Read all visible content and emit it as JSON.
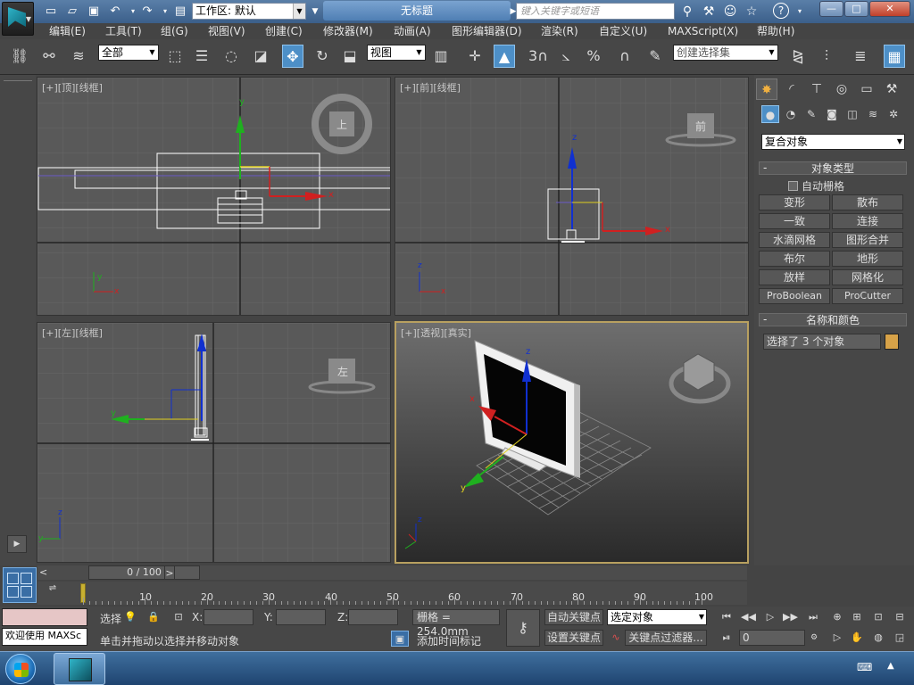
{
  "titlebar": {
    "workspace_label": "工作区: 默认",
    "window_title": "无标题",
    "search_placeholder": "键入关键字或短语",
    "min": "—",
    "max": "□",
    "close": "✕",
    "help": "?"
  },
  "menu": [
    "编辑(E)",
    "工具(T)",
    "组(G)",
    "视图(V)",
    "创建(C)",
    "修改器(M)",
    "动画(A)",
    "图形编辑器(D)",
    "渲染(R)",
    "自定义(U)",
    "MAXScript(X)",
    "帮助(H)"
  ],
  "toolbar": {
    "filter_value": "全部",
    "refcoord_value": "视图",
    "named_selection_placeholder": "创建选择集",
    "snap_label": "3",
    "percent_label": "%"
  },
  "viewports": {
    "top": {
      "label": "[+][顶][线框]",
      "cube": "上"
    },
    "front": {
      "label": "[+][前][线框]",
      "cube": "前"
    },
    "left": {
      "label": "[+][左][线框]",
      "cube": "左"
    },
    "perspective": {
      "label": "[+][透视][真实]"
    }
  },
  "axes": {
    "x": "x",
    "y": "y",
    "z": "z"
  },
  "command_panel": {
    "category_value": "复合对象",
    "object_type_title": "对象类型",
    "autogrid_label": "自动栅格",
    "buttons": [
      "变形",
      "散布",
      "一致",
      "连接",
      "水滴网格",
      "图形合并",
      "布尔",
      "地形",
      "放样",
      "网格化",
      "ProBoolean",
      "ProCutter"
    ],
    "name_color_title": "名称和颜色",
    "selection_name": "选择了 3 个对象",
    "swatch_color": "#d7a248"
  },
  "timeline": {
    "slider_text": "0 / 100",
    "prev": "<",
    "next": ">",
    "ticks": [
      "10",
      "20",
      "30",
      "40",
      "50",
      "60",
      "70",
      "80",
      "90",
      "100"
    ]
  },
  "status": {
    "maxscript_text": "欢迎使用 MAXSc",
    "select_label": "选择",
    "prompt": "单击并拖动以选择并移动对象",
    "x_label": "X:",
    "y_label": "Y:",
    "z_label": "Z:",
    "grid_text": "栅格 = 254.0mm",
    "add_time_tag": "添加时间标记",
    "auto_key": "自动关键点",
    "set_key": "设置关键点",
    "key_mode_value": "选定对象",
    "key_filters": "关键点过滤器...",
    "frame_value": "0"
  }
}
